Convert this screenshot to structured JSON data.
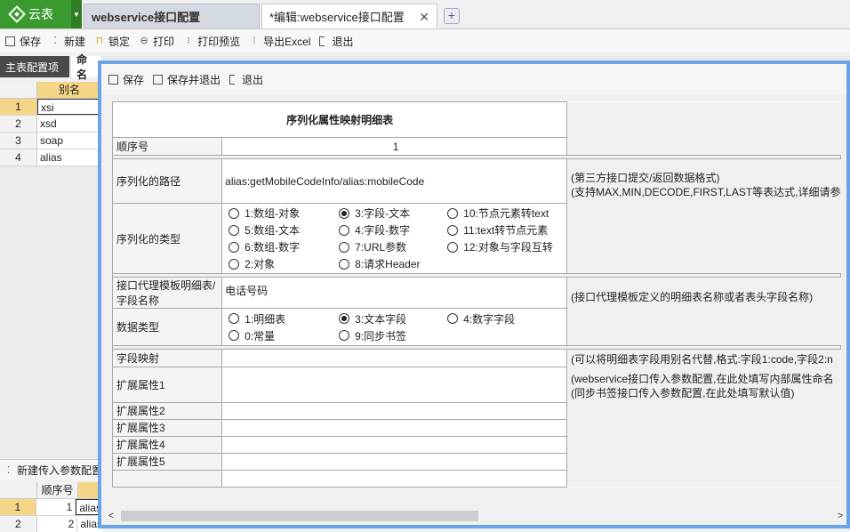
{
  "app": {
    "label": "云表"
  },
  "tabs": [
    {
      "label": "webservice接口配置"
    },
    {
      "label": "*编辑:webservice接口配置",
      "close": "✕"
    }
  ],
  "toolbar": {
    "save": "保存",
    "new": "新建",
    "lock": "锁定",
    "print": "打印",
    "print_preview": "打印预览",
    "export_excel": "导出Excel",
    "exit": "退出"
  },
  "subtabs": {
    "main": "主表配置项",
    "second": "命名"
  },
  "grid1": {
    "header": "别名",
    "rows": [
      {
        "n": "1",
        "v": "xsi"
      },
      {
        "n": "2",
        "v": "xsd"
      },
      {
        "n": "3",
        "v": "soap"
      },
      {
        "n": "4",
        "v": "alias"
      }
    ]
  },
  "new_param": "新建传入参数配置",
  "grid2": {
    "header_num": "顺序号",
    "rows": [
      {
        "n": "1",
        "num": "1",
        "v": "alias"
      },
      {
        "n": "2",
        "num": "2",
        "v": "alias"
      }
    ]
  },
  "dialog": {
    "toolbar": {
      "save": "保存",
      "save_exit": "保存并退出",
      "exit": "退出"
    },
    "title": "序列化属性映射明细表",
    "fields": {
      "seq_label": "顺序号",
      "seq_value": "1",
      "path_label": "序列化的路径",
      "path_value": "alias:getMobileCodeInfo/alias:mobileCode",
      "path_note1": "(第三方接口提交/返回数据格式)",
      "path_note2": "(支持MAX,MIN,DECODE,FIRST,LAST等表达式,详细请参",
      "type_label": "序列化的类型",
      "type_options": [
        {
          "label": "1:数组-对象",
          "on": false
        },
        {
          "label": "3:字段-文本",
          "on": true
        },
        {
          "label": "10:节点元素转text",
          "on": false
        },
        {
          "label": "5:数组-文本",
          "on": false
        },
        {
          "label": "4:字段-数字",
          "on": false
        },
        {
          "label": "11:text转节点元素",
          "on": false
        },
        {
          "label": "6:数组-数字",
          "on": false
        },
        {
          "label": "7:URL参数",
          "on": false
        },
        {
          "label": "12:对象与字段互转",
          "on": false
        },
        {
          "label": "2:对象",
          "on": false
        },
        {
          "label": "8:请求Header",
          "on": false
        }
      ],
      "proxy_label": "接口代理模板明细表/字段名称",
      "proxy_value": "电话号码",
      "proxy_note": "(接口代理模板定义的明细表名称或者表头字段名称)",
      "dtype_label": "数据类型",
      "dtype_options": [
        {
          "label": "1:明细表",
          "on": false
        },
        {
          "label": "3:文本字段",
          "on": true
        },
        {
          "label": "4:数字字段",
          "on": false
        },
        {
          "label": "0:常量",
          "on": false
        },
        {
          "label": "9:同步书签",
          "on": false
        }
      ],
      "map_label": "字段映射",
      "map_note": "(可以将明细表字段用别名代替,格式:字段1:code,字段2:n",
      "ext1_label": "扩展属性1",
      "ext1_note1": "(webservice接口传入参数配置,在此处填写内部属性命名",
      "ext1_note2": "(同步书签接口传入参数配置,在此处填写默认值)",
      "ext2_label": "扩展属性2",
      "ext3_label": "扩展属性3",
      "ext4_label": "扩展属性4",
      "ext5_label": "扩展属性5"
    }
  }
}
